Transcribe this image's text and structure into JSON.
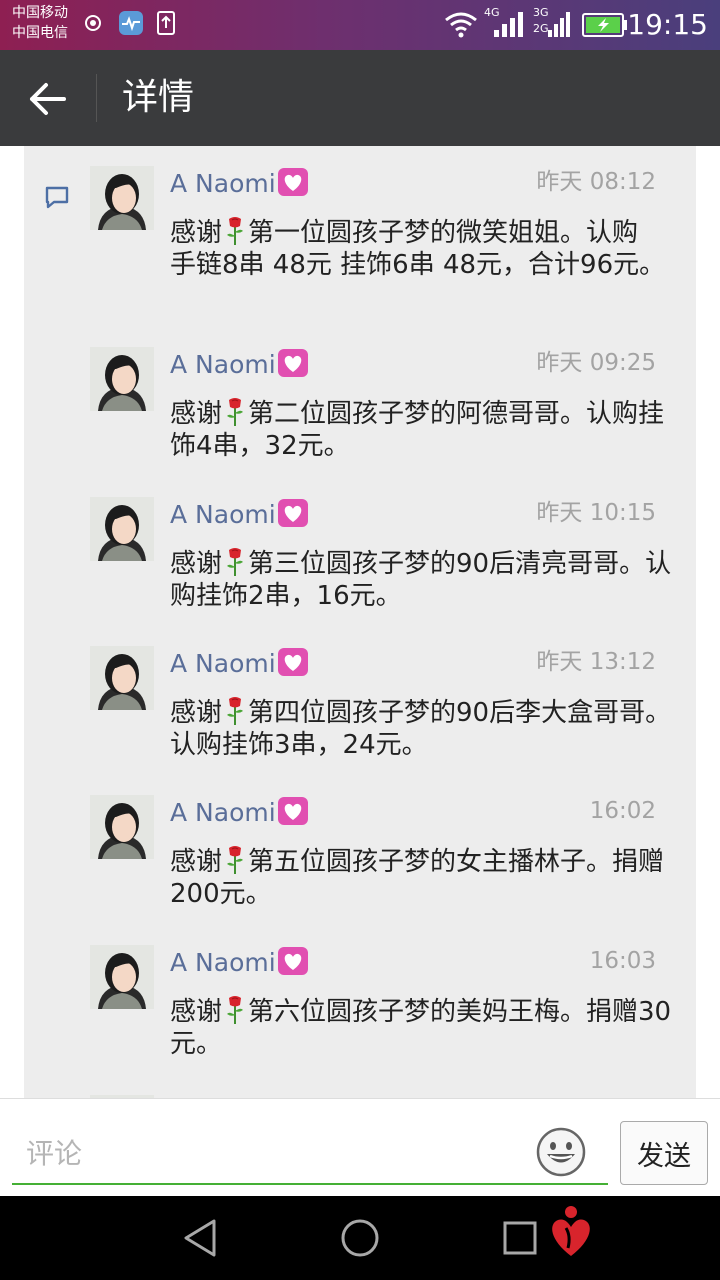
{
  "status": {
    "carrier_1": "中国移动",
    "carrier_2": "中国电信",
    "net_1": "4G",
    "net_2": "3G",
    "net_3": "2G",
    "time": "19:15"
  },
  "header": {
    "title": "详情",
    "back_icon": "arrow-left-icon"
  },
  "comments": [
    {
      "name": "A Naomi",
      "time": "昨天 08:12",
      "pre": "感谢",
      "body": "第一位圆孩子梦的微笑姐姐。认购 手链8串  48元  挂饰6串  48元，合计96元。"
    },
    {
      "name": "A Naomi",
      "time": "昨天 09:25",
      "pre": "感谢",
      "body": "第二位圆孩子梦的阿德哥哥。认购挂饰4串，32元。"
    },
    {
      "name": "A Naomi",
      "time": "昨天 10:15",
      "pre": "感谢",
      "body": "第三位圆孩子梦的90后清亮哥哥。认购挂饰2串，16元。"
    },
    {
      "name": "A Naomi",
      "time": "昨天 13:12",
      "pre": "感谢",
      "body": "第四位圆孩子梦的90后李大盒哥哥。认购挂饰3串，24元。"
    },
    {
      "name": "A Naomi",
      "time": "16:02",
      "pre": "感谢",
      "body": "第五位圆孩子梦的女主播林子。捐赠200元。"
    },
    {
      "name": "A Naomi",
      "time": "16:03",
      "pre": "感谢",
      "body": "第六位圆孩子梦的美妈王梅。捐赠30元。"
    }
  ],
  "input": {
    "placeholder": "评论",
    "send_label": "发送"
  },
  "colors": {
    "status_bar": "#8e1f52",
    "app_bar": "#3a3b3d",
    "name": "#5a6e99",
    "accent_line": "#45b035"
  }
}
